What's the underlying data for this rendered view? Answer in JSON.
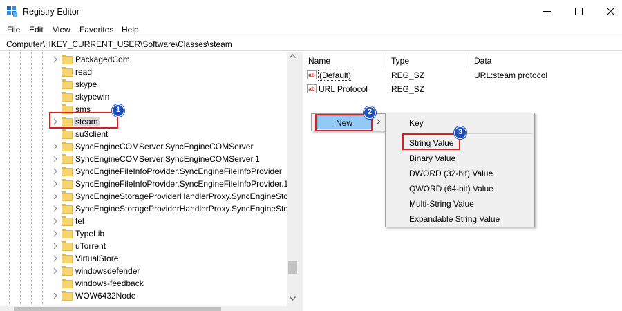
{
  "window": {
    "title": "Registry Editor",
    "controls": {
      "minimize": "minimize-icon",
      "maximize": "maximize-icon",
      "close": "close-icon"
    }
  },
  "menubar": {
    "items": [
      "File",
      "Edit",
      "View",
      "Favorites",
      "Help"
    ]
  },
  "address": {
    "path": "Computer\\HKEY_CURRENT_USER\\Software\\Classes\\steam"
  },
  "tree": {
    "items": [
      {
        "label": "PackagedCom",
        "expandable": true
      },
      {
        "label": "read",
        "expandable": false
      },
      {
        "label": "skype",
        "expandable": false
      },
      {
        "label": "skypewin",
        "expandable": false
      },
      {
        "label": "sms",
        "expandable": false
      },
      {
        "label": "steam",
        "expandable": true,
        "selected": true
      },
      {
        "label": "su3client",
        "expandable": false
      },
      {
        "label": "SyncEngineCOMServer.SyncEngineCOMServer",
        "expandable": true
      },
      {
        "label": "SyncEngineCOMServer.SyncEngineCOMServer.1",
        "expandable": true
      },
      {
        "label": "SyncEngineFileInfoProvider.SyncEngineFileInfoProvider",
        "expandable": true
      },
      {
        "label": "SyncEngineFileInfoProvider.SyncEngineFileInfoProvider.1",
        "expandable": true
      },
      {
        "label": "SyncEngineStorageProviderHandlerProxy.SyncEngineStora",
        "expandable": true
      },
      {
        "label": "SyncEngineStorageProviderHandlerProxy.SyncEngineStora",
        "expandable": true
      },
      {
        "label": "tel",
        "expandable": true
      },
      {
        "label": "TypeLib",
        "expandable": true
      },
      {
        "label": "uTorrent",
        "expandable": true
      },
      {
        "label": "VirtualStore",
        "expandable": true
      },
      {
        "label": "windowsdefender",
        "expandable": true
      },
      {
        "label": "windows-feedback",
        "expandable": false
      },
      {
        "label": "WOW6432Node",
        "expandable": true
      }
    ]
  },
  "values": {
    "headers": {
      "name": "Name",
      "type": "Type",
      "data": "Data"
    },
    "rows": [
      {
        "name": "(Default)",
        "type": "REG_SZ",
        "data": "URL:steam protocol"
      },
      {
        "name": "URL Protocol",
        "type": "REG_SZ",
        "data": ""
      }
    ]
  },
  "context_menu": {
    "new_label": "New"
  },
  "submenu": {
    "items": [
      "Key",
      "String Value",
      "Binary Value",
      "DWORD (32-bit) Value",
      "QWORD (64-bit) Value",
      "Multi-String Value",
      "Expandable String Value"
    ]
  },
  "callouts": {
    "one": "1",
    "two": "2",
    "three": "3"
  },
  "colors": {
    "callout_border": "#e01b1b",
    "badge_fill": "#1f4fb8",
    "menu_highlight": "#91c9f7"
  }
}
